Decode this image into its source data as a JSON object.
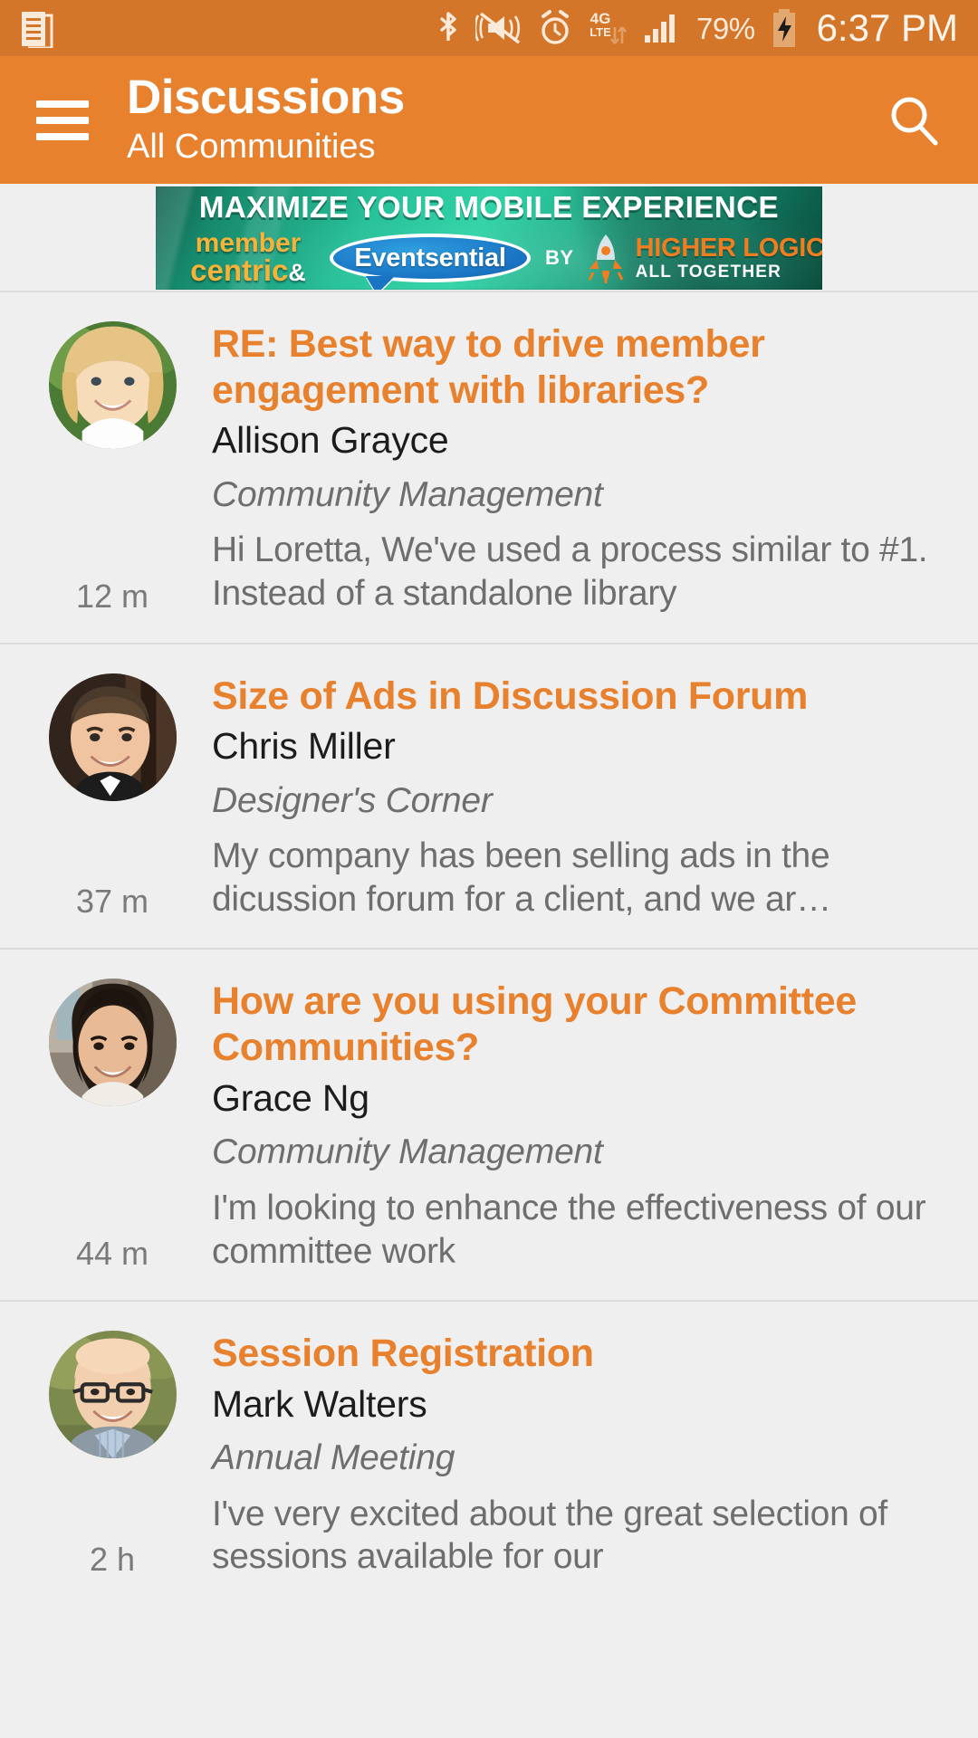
{
  "status_bar": {
    "icons": [
      "document-icon",
      "bluetooth-icon",
      "mute-vibrate-icon",
      "alarm-icon",
      "4g-lte-icon",
      "signal-bars-icon"
    ],
    "battery_percent": "79%",
    "battery_icon": "battery-charging-icon",
    "time": "6:37 PM"
  },
  "app_bar": {
    "menu_icon": "hamburger-menu-icon",
    "title": "Discussions",
    "subtitle": "All Communities",
    "search_icon": "search-icon",
    "background_color": "#e8812e"
  },
  "ad_banner": {
    "headline": "MAXIMIZE YOUR MOBILE EXPERIENCE",
    "line_member": "member",
    "line_centric": "centric",
    "ampersand": "&",
    "product": "Eventsential",
    "by": "BY",
    "brand": "HIGHER LOGIC",
    "tagline": "ALL TOGETHER"
  },
  "theme": {
    "accent": "#e8812e",
    "status_bar_bg": "#d4762a",
    "page_bg": "#efefef",
    "title_color": "#e8812e",
    "author_color": "#1c1c1c",
    "meta_color": "#6e6e6e"
  },
  "discussions": [
    {
      "title": "RE: Best way to drive member engagement with libraries?",
      "author": "Allison Grayce",
      "community": "Community Management",
      "snippet": "Hi Loretta, We've used a process similar to #1. Instead of a standalone library",
      "time": "12 m",
      "avatar": "avatar-allison-grayce"
    },
    {
      "title": "Size of Ads in Discussion Forum",
      "author": "Chris Miller",
      "community": "Designer's Corner",
      "snippet": "My company has been selling ads in the dicussion forum for a client, and we ar…",
      "time": "37 m",
      "avatar": "avatar-chris-miller"
    },
    {
      "title": "How are you using your Committee Communities?",
      "author": "Grace Ng",
      "community": "Community Management",
      "snippet": "I'm looking to enhance the effectiveness of our committee work",
      "time": "44 m",
      "avatar": "avatar-grace-ng"
    },
    {
      "title": "Session Registration",
      "author": "Mark Walters",
      "community": "Annual Meeting",
      "snippet": "I've very excited about the great selection of sessions available for our",
      "time": "2 h",
      "avatar": "avatar-mark-walters"
    }
  ]
}
